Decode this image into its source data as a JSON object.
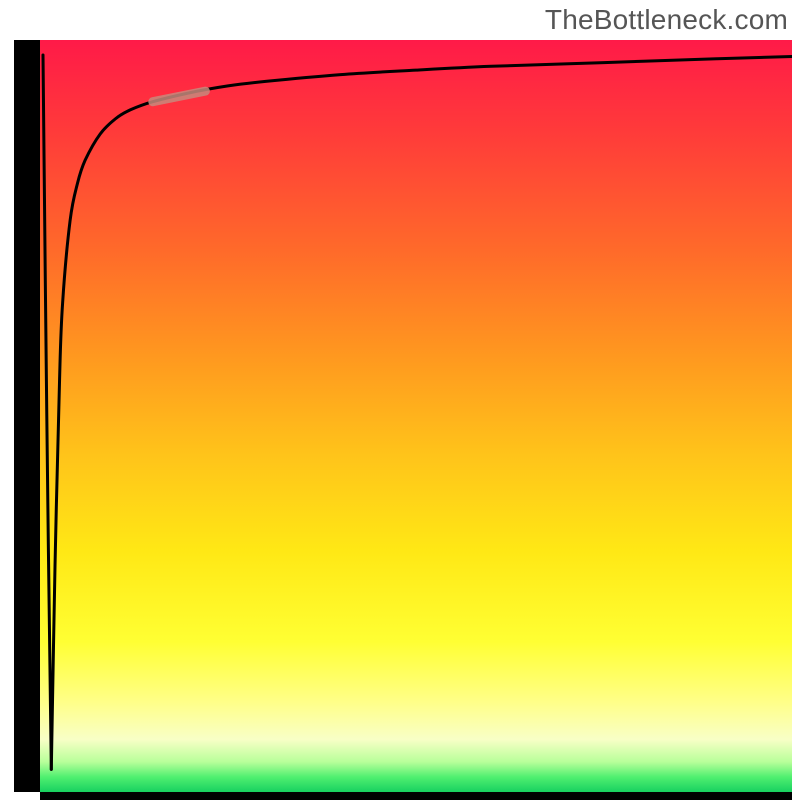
{
  "watermark": "TheBottleneck.com",
  "colors": {
    "axis": "#000000",
    "curve": "#000000",
    "marker": "#c78a7d",
    "gradient_stops": [
      "#ff1a48",
      "#ff3a3a",
      "#ff6a2a",
      "#ff981f",
      "#ffc31a",
      "#ffe815",
      "#ffff33",
      "#ffff88",
      "#f8ffc6",
      "#b8ff9a",
      "#50f070",
      "#18d060"
    ]
  },
  "chart_data": {
    "type": "line",
    "title": "",
    "xlabel": "",
    "ylabel": "",
    "xlim": [
      0,
      100
    ],
    "ylim": [
      0,
      100
    ],
    "grid": false,
    "legend": false,
    "series": [
      {
        "name": "main-curve",
        "x": [
          1.5,
          2,
          2.6,
          3,
          4,
          5,
          6,
          8,
          10,
          12,
          15,
          20,
          25,
          30,
          40,
          50,
          60,
          75,
          90,
          100
        ],
        "y": [
          3,
          30,
          55,
          65,
          76,
          81,
          84,
          87.5,
          89.5,
          90.7,
          91.8,
          93,
          93.9,
          94.5,
          95.4,
          96,
          96.5,
          97,
          97.5,
          97.8
        ]
      },
      {
        "name": "initial-spike",
        "x": [
          0.4,
          0.9,
          1.5
        ],
        "y": [
          98,
          50,
          3
        ]
      },
      {
        "name": "highlight-segment",
        "x": [
          15,
          22
        ],
        "y": [
          91.8,
          93.2
        ]
      }
    ]
  }
}
